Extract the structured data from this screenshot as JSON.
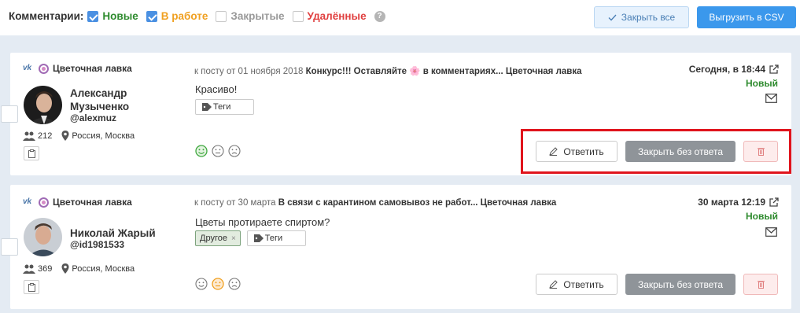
{
  "toolbar": {
    "label": "Комментарии:",
    "filters": [
      {
        "label": "Новые",
        "checked": true,
        "color": "#2e8b2e"
      },
      {
        "label": "В работе",
        "checked": true,
        "color": "#f0a020"
      },
      {
        "label": "Закрытые",
        "checked": false,
        "color": "#999999"
      },
      {
        "label": "Удалённые",
        "checked": false,
        "color": "#e04040"
      }
    ],
    "help_icon": "question-icon",
    "close_all_label": "Закрыть все",
    "export_label": "Выгрузить в CSV"
  },
  "comments": [
    {
      "source": "Цветочная лавка",
      "author": "Александр Музыченко",
      "author_line1": "Александр",
      "author_line2": "Музыченко",
      "handle": "@alexmuz",
      "followers": "212",
      "location": "Россия, Москва",
      "post_prefix": "к посту от 01 ноября 2018",
      "post_title": "Конкурс!!! Оставляйте 🌸 в комментариях... Цветочная лавка",
      "text": "Красиво!",
      "tags_label": "Теги",
      "chips": [],
      "sentiment": "positive",
      "date": "Сегодня, в 18:44",
      "status": "Новый",
      "reply_label": "Ответить",
      "close_label": "Закрыть без ответа"
    },
    {
      "source": "Цветочная лавка",
      "author": "Николай Жарый",
      "author_line1": "Николай Жарый",
      "author_line2": "",
      "handle": "@id1981533",
      "followers": "369",
      "location": "Россия, Москва",
      "post_prefix": "к посту от 30 марта",
      "post_title": "В связи с карантином самовывоз не работ... Цветочная лавка",
      "text": "Цветы протираете спиртом?",
      "tags_label": "Теги",
      "chips": [
        "Другое"
      ],
      "sentiment": "neutral",
      "date": "30 марта 12:19",
      "status": "Новый",
      "reply_label": "Ответить",
      "close_label": "Закрыть без ответа"
    }
  ]
}
